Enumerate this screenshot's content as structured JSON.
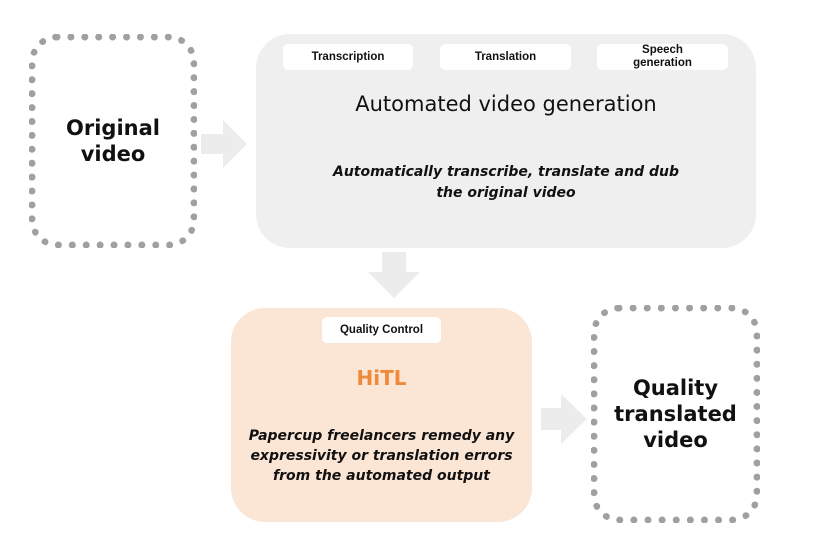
{
  "diagram": {
    "input": {
      "label": "Original\nvideo"
    },
    "automated": {
      "title": "Automated video generation",
      "steps": [
        "Transcription",
        "Translation",
        "Speech\ngeneration"
      ],
      "description": "Automatically transcribe, translate and dub\nthe original video"
    },
    "human_in_the_loop": {
      "tag": "Quality Control",
      "title": "HiTL",
      "description": "Papercup freelancers remedy any\nexpressivity or translation errors\nfrom the automated output"
    },
    "output": {
      "label": "Quality\ntranslated\nvideo"
    },
    "colors": {
      "automated_bg": "#efefef",
      "hitl_bg": "#fbe5d5",
      "hitl_accent": "#ee8a3a",
      "arrow": "#ececec",
      "dotted_border": "#a0a0a0"
    }
  }
}
